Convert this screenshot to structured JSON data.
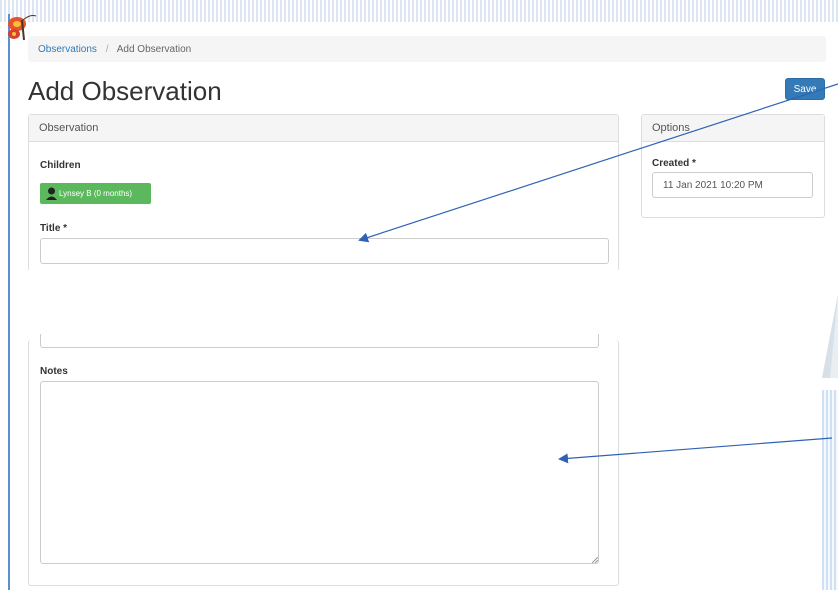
{
  "breadcrumb": {
    "parent_label": "Observations",
    "separator": "/",
    "current_label": "Add Observation"
  },
  "page": {
    "title": "Add Observation"
  },
  "toolbar": {
    "save_label": "Save"
  },
  "observation_panel": {
    "heading": "Observation",
    "children_label": "Children",
    "child_chip_label": "Lynsey B (0 months)",
    "title_label": "Title *",
    "title_value": "",
    "notes_label": "Notes",
    "notes_value": ""
  },
  "options_panel": {
    "heading": "Options",
    "created_label": "Created *",
    "created_value": "11 Jan 2021 10:20 PM"
  },
  "colors": {
    "primary": "#337ab7",
    "success": "#5cb85c",
    "annotation_arrow": "#2f62b5"
  },
  "icons": {
    "logo": "butterfly-logo",
    "avatar": "child-avatar-icon",
    "resize": "resize-grip-icon"
  }
}
